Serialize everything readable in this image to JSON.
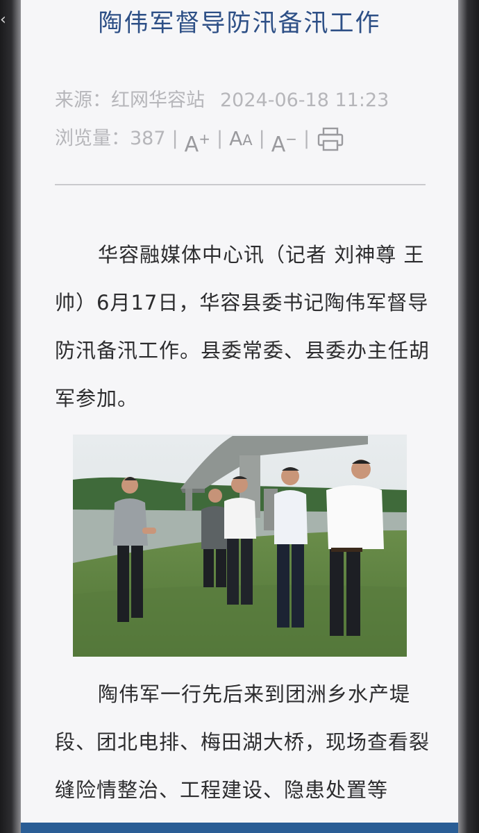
{
  "article": {
    "title": "陶伟军督导防汛备汛工作",
    "source_label": "来源：",
    "source": "红网华容站",
    "datetime": "2024-06-18 11:23",
    "views_label": "浏览量：",
    "views": "387",
    "paragraphs": [
      "华容融媒体中心讯（记者 刘神尊 王帅）6月17日，华容县委书记陶伟军督导防汛备汛工作。县委常委、县委办主任胡军参加。",
      "陶伟军一行先后来到团洲乡水产堤段、团北电排、梅田湖大桥，现场查看裂缝险情整治、工程建设、隐患处置等"
    ]
  },
  "toolbar": {
    "increase_font": "A",
    "increase_sign": "+",
    "reset_font_big": "A",
    "reset_font_small": "A",
    "decrease_font": "A",
    "decrease_sign": "−",
    "separator": "|",
    "icons": [
      "font-increase-icon",
      "font-reset-icon",
      "font-decrease-icon",
      "print-icon"
    ]
  },
  "nav": {
    "back_glyph": "‹",
    "back_icon": "back-chevron-icon"
  },
  "colors": {
    "title": "#2d4f86",
    "meta": "#b6b6ba",
    "body_text": "#2c2c2e",
    "page_bg": "#f6f6f8",
    "bottom_bar": "#2a5d95"
  }
}
